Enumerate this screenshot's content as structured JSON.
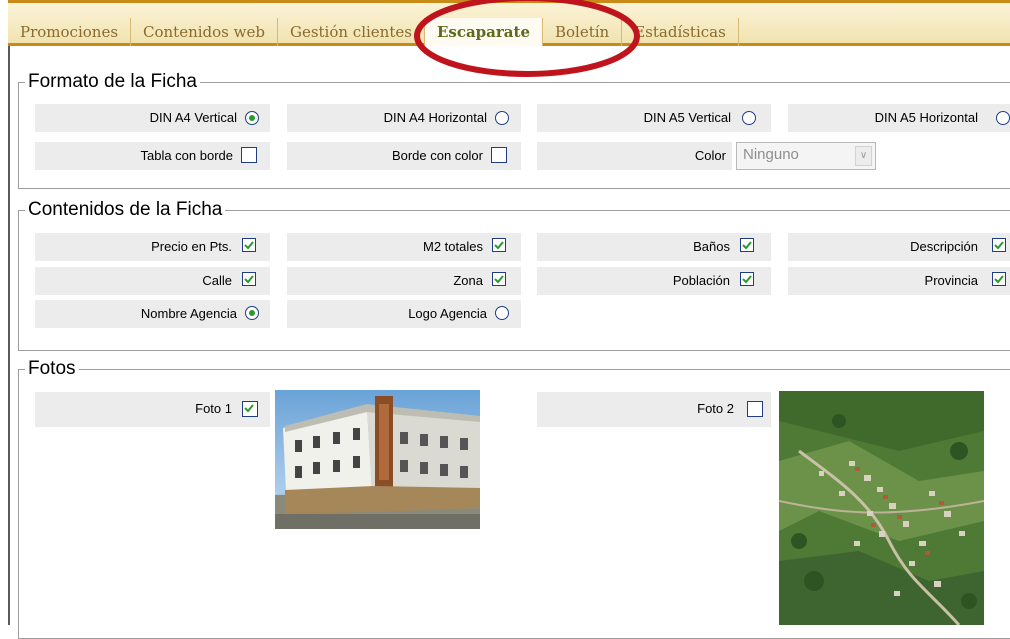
{
  "tabs": [
    {
      "label": "Promociones",
      "active": false
    },
    {
      "label": "Contenidos web",
      "active": false
    },
    {
      "label": "Gestión clientes",
      "active": false
    },
    {
      "label": "Escaparate",
      "active": true
    },
    {
      "label": "Boletín",
      "active": false
    },
    {
      "label": "Estadísticas",
      "active": false
    }
  ],
  "formato": {
    "legend": "Formato de la Ficha",
    "din_a4_vertical": {
      "label": "DIN A4 Vertical",
      "selected": true
    },
    "din_a4_horizontal": {
      "label": "DIN A4 Horizontal",
      "selected": false
    },
    "din_a5_vertical": {
      "label": "DIN A5 Vertical",
      "selected": false
    },
    "din_a5_horizontal": {
      "label": "DIN A5 Horizontal",
      "selected": false
    },
    "tabla_con_borde": {
      "label": "Tabla con borde",
      "checked": false
    },
    "borde_con_color": {
      "label": "Borde con color",
      "checked": false
    },
    "color": {
      "label": "Color",
      "value": "Ninguno"
    }
  },
  "contenidos": {
    "legend": "Contenidos de la Ficha",
    "precio": {
      "label": "Precio en Pts.",
      "checked": true
    },
    "m2": {
      "label": "M2 totales",
      "checked": true
    },
    "banos": {
      "label": "Baños",
      "checked": true
    },
    "descripcion": {
      "label": "Descripción",
      "checked": true
    },
    "calle": {
      "label": "Calle",
      "checked": true
    },
    "zona": {
      "label": "Zona",
      "checked": true
    },
    "poblacion": {
      "label": "Población",
      "checked": true
    },
    "provincia": {
      "label": "Provincia",
      "checked": true
    },
    "nombre_agencia": {
      "label": "Nombre Agencia",
      "selected": true
    },
    "logo_agencia": {
      "label": "Logo Agencia",
      "selected": false
    }
  },
  "fotos": {
    "legend": "Fotos",
    "foto1": {
      "label": "Foto 1",
      "checked": true
    },
    "foto2": {
      "label": "Foto 2",
      "checked": false
    }
  },
  "colors": {
    "tab_border": "#c98a18",
    "active_tab_text": "#5c6a1c",
    "highlight_oval": "#c0141c",
    "check_green": "#2a9a2a"
  }
}
